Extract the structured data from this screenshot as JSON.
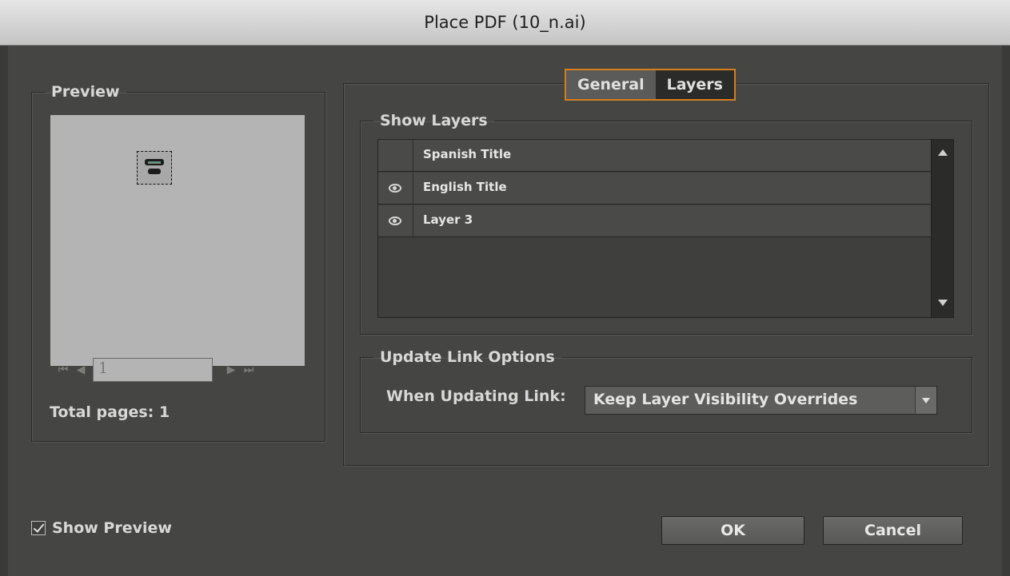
{
  "window": {
    "title": "Place PDF (10_n.ai)"
  },
  "preview": {
    "legend": "Preview",
    "page_value": "1",
    "total_pages_label": "Total pages: 1",
    "nav": {
      "first": "⏮",
      "prev": "◀",
      "next": "▶",
      "last": "⏭"
    }
  },
  "tabs": [
    {
      "label": "General",
      "selected": false
    },
    {
      "label": "Layers",
      "selected": true
    }
  ],
  "show_layers": {
    "legend": "Show Layers",
    "layers": [
      {
        "name": "Spanish Title",
        "visible": false
      },
      {
        "name": "English Title",
        "visible": true
      },
      {
        "name": "Layer 3",
        "visible": true
      }
    ]
  },
  "update_link": {
    "legend": "Update Link Options",
    "label": "When Updating Link:",
    "selected": "Keep Layer Visibility Overrides"
  },
  "show_preview": {
    "label": "Show Preview",
    "checked": true
  },
  "buttons": {
    "ok": "OK",
    "cancel": "Cancel"
  },
  "colors": {
    "accent_tab_border": "#d47f1c",
    "panel_bg": "#454543"
  }
}
